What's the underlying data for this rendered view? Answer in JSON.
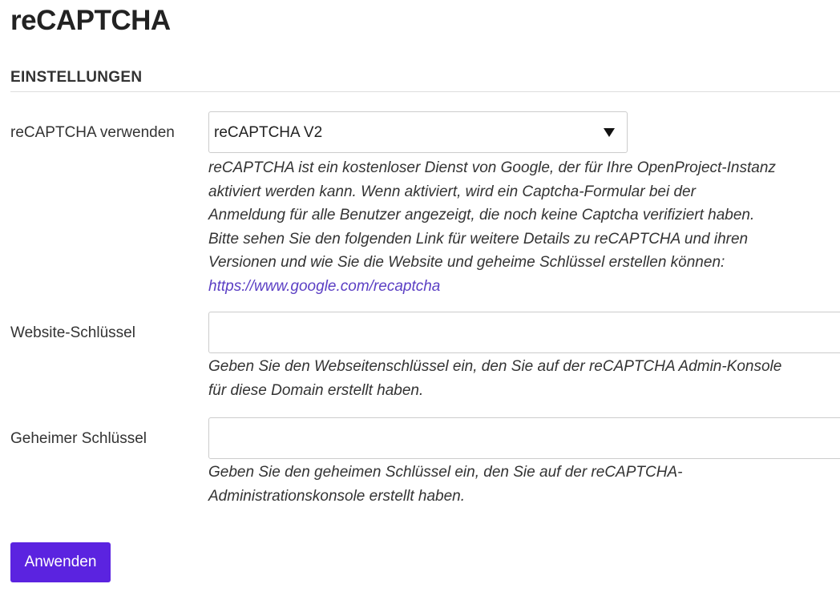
{
  "page": {
    "title": "reCAPTCHA"
  },
  "section": {
    "title": "EINSTELLUNGEN"
  },
  "fields": {
    "recaptcha_mode": {
      "label": "reCAPTCHA verwenden",
      "value": "reCAPTCHA V2",
      "help_lines": [
        "reCAPTCHA ist ein kostenloser Dienst von Google, der für Ihre OpenProject-Instanz",
        "aktiviert werden kann. Wenn aktiviert, wird ein Captcha-Formular bei der",
        "Anmeldung für alle Benutzer angezeigt, die noch keine Captcha verifiziert haben.",
        "Bitte sehen Sie den folgenden Link für weitere Details zu reCAPTCHA und ihren",
        "Versionen und wie Sie die Website und geheime Schlüssel erstellen können:"
      ],
      "help_link": "https://www.google.com/recaptcha"
    },
    "website_key": {
      "label": "Website-Schlüssel",
      "value": "",
      "help_lines": [
        "Geben Sie den Webseitenschlüssel ein, den Sie auf der reCAPTCHA Admin-Konsole",
        "für diese Domain erstellt haben."
      ]
    },
    "secret_key": {
      "label": "Geheimer Schlüssel",
      "value": "",
      "help_lines": [
        "Geben Sie den geheimen Schlüssel ein, den Sie auf der reCAPTCHA-",
        "Administrationskonsole erstellt haben."
      ]
    }
  },
  "actions": {
    "apply_label": "Anwenden",
    "accent_color": "#5b23e0"
  },
  "colors": {
    "link": "#5b3fc4"
  }
}
